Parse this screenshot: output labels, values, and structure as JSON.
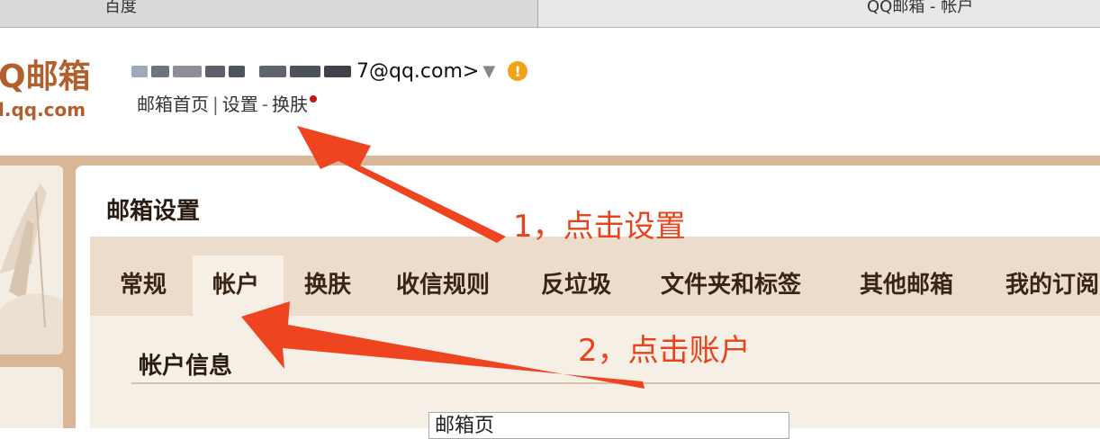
{
  "browser_tabs": [
    {
      "label": "百度"
    },
    {
      "label": "QQ邮箱 - 帐户"
    }
  ],
  "logo": {
    "main": "Q邮箱",
    "sub": "l.qq.com"
  },
  "account": {
    "email_visible": "7@qq.com>"
  },
  "top_links": {
    "home": "邮箱首页",
    "sep1": "|",
    "settings": "设置",
    "sep2": "-",
    "skin": "换肤"
  },
  "page": {
    "title": "邮箱设置",
    "section_title": "帐户信息",
    "field_value": "邮箱页"
  },
  "tabs": [
    {
      "label": "常规"
    },
    {
      "label": "帐户"
    },
    {
      "label": "换肤"
    },
    {
      "label": "收信规则"
    },
    {
      "label": "反垃圾"
    },
    {
      "label": "文件夹和标签"
    },
    {
      "label": "其他邮箱"
    },
    {
      "label": "我的订阅"
    }
  ],
  "annotations": {
    "step1": "1，点击设置",
    "step2": "2，点击账户"
  },
  "colors": {
    "brand": "#b15f2d",
    "annotation": "#e8431b",
    "tab_bar": "#ecdccb",
    "frame": "#d9b797"
  }
}
